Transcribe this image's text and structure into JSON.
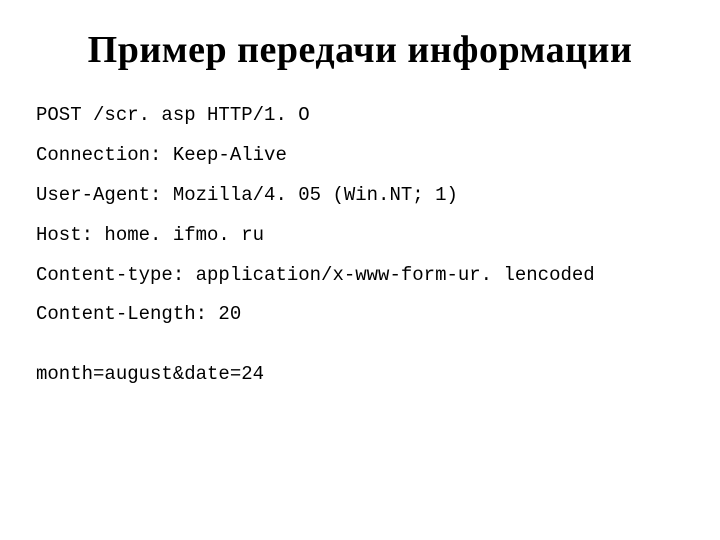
{
  "title": "Пример передачи информации",
  "lines": {
    "l0": "POST /scr. asp HTTP/1. O",
    "l1": "Connection: Keep-Alive",
    "l2": "User-Agent: Mozilla/4. 05 (Win.NT; 1)",
    "l3": "Host: home. ifmo. ru",
    "l4": "Content-type: application/x-www-form-ur. lencoded",
    "l5": "Content-Length: 20",
    "l6": "month=august&date=24"
  }
}
